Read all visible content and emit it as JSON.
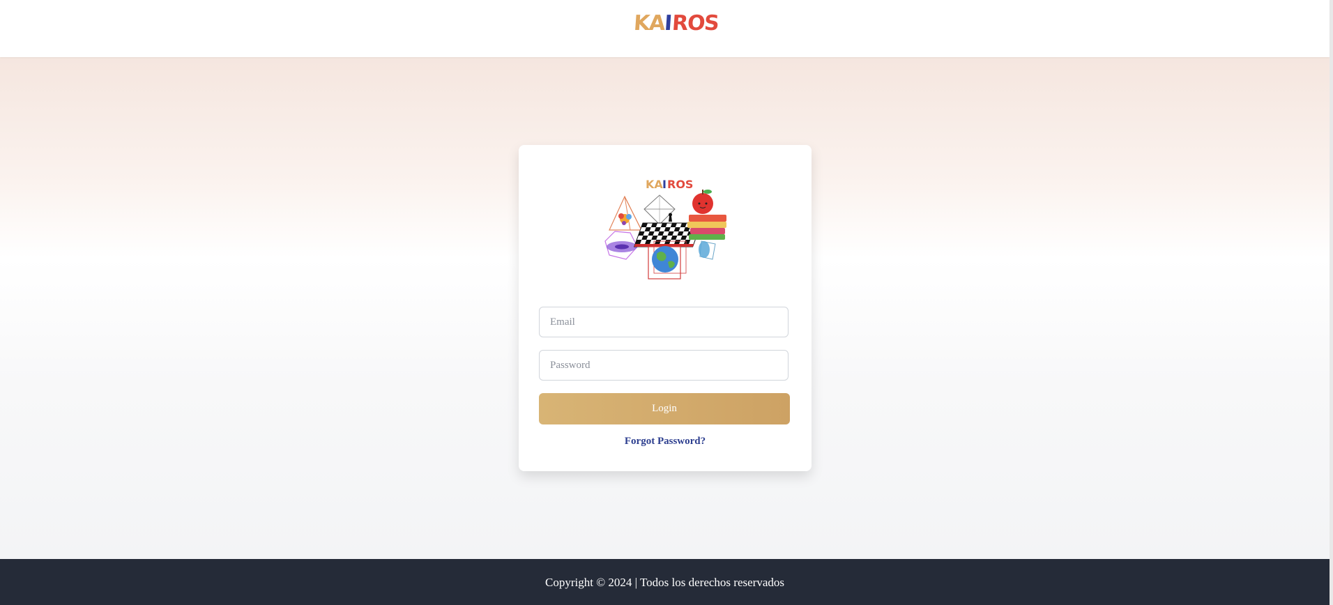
{
  "header": {
    "brand_letters": [
      {
        "text": "K",
        "color": "#e0a75e"
      },
      {
        "text": "A",
        "color": "#e0a75e"
      },
      {
        "text": "I",
        "color": "#2f3f9e"
      },
      {
        "text": "R",
        "color": "#e24a3d"
      },
      {
        "text": "O",
        "color": "#e24a3d"
      },
      {
        "text": "S",
        "color": "#e24a3d"
      }
    ]
  },
  "login": {
    "illustration_icon": "kairos-logo-illustration",
    "email_placeholder": "Email",
    "email_value": "",
    "password_placeholder": "Password",
    "password_value": "",
    "login_label": "Login",
    "forgot_label": "Forgot Password?"
  },
  "footer": {
    "copyright": "Copyright © 2024 | Todos los derechos reservados"
  },
  "colors": {
    "accent": "#d4ad6e",
    "link": "#2c3e8f",
    "footer_bg": "#252b38"
  }
}
